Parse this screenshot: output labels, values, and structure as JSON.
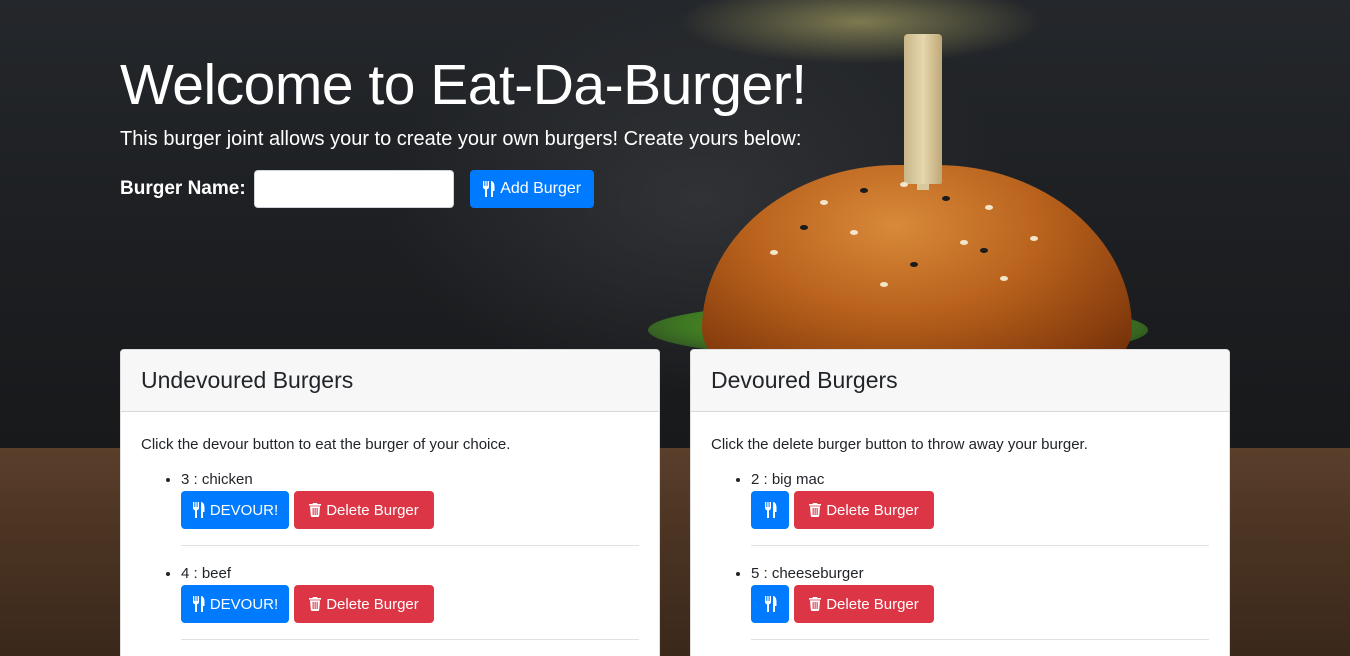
{
  "header": {
    "title": "Welcome to Eat-Da-Burger!",
    "lead": "This burger joint allows your to create your own burgers! Create yours below:"
  },
  "form": {
    "label": "Burger Name:",
    "input_value": "",
    "input_placeholder": "",
    "add_button_label": "Add Burger",
    "add_button_icon": "utensils-icon"
  },
  "undevoured": {
    "title": "Undevoured Burgers",
    "instructions": "Click the devour button to eat the burger of your choice.",
    "items": [
      {
        "label": "3 : chicken",
        "devour_label": "DEVOUR!",
        "delete_label": "Delete Burger"
      },
      {
        "label": "4 : beef",
        "devour_label": "DEVOUR!",
        "delete_label": "Delete Burger"
      }
    ]
  },
  "devoured": {
    "title": "Devoured Burgers",
    "instructions": "Click the delete burger button to throw away your burger.",
    "items": [
      {
        "label": "2 : big mac",
        "delete_label": "Delete Burger"
      },
      {
        "label": "5 : cheeseburger",
        "delete_label": "Delete Burger"
      }
    ]
  },
  "colors": {
    "primary": "#007bff",
    "danger": "#dc3545",
    "card_header": "#f7f7f7"
  }
}
